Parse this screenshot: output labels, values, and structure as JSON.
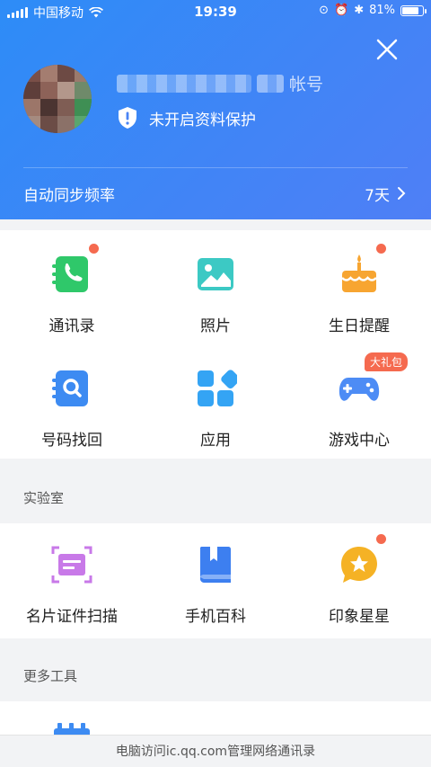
{
  "status_bar": {
    "carrier": "中国移动",
    "time": "19:39",
    "battery": "81%",
    "battery_level": 0.81
  },
  "header": {
    "account_suffix": "帐号",
    "protection_text": "未开启资料保护",
    "sync_label": "自动同步频率",
    "sync_value": "7天"
  },
  "top_grid": [
    {
      "label": "通讯录"
    },
    {
      "label": "照片"
    },
    {
      "label": "生日提醒"
    },
    {
      "label": "号码找回"
    },
    {
      "label": "应用"
    },
    {
      "label": "游戏中心",
      "badge": "大礼包"
    }
  ],
  "lab": {
    "title": "实验室",
    "items": [
      {
        "label": "名片证件扫描"
      },
      {
        "label": "手机百科"
      },
      {
        "label": "印象星星"
      }
    ]
  },
  "more_tools": {
    "title": "更多工具"
  },
  "footer": {
    "text": "电脑访问ic.qq.com管理网络通讯录"
  },
  "colors": {
    "header_blue": "#3a86f6",
    "badge_red": "#f56a4f",
    "contacts_green": "#2fc86a",
    "photo_teal": "#3cc9c4",
    "birthday_orange": "#f7a531",
    "recover_blue": "#3d8bf2",
    "apps_blue": "#34a4f4",
    "game_blue": "#4d8cf5",
    "scan_purple": "#c879e8",
    "wiki_blue": "#3d7ff0",
    "star_yellow": "#f5b225"
  }
}
